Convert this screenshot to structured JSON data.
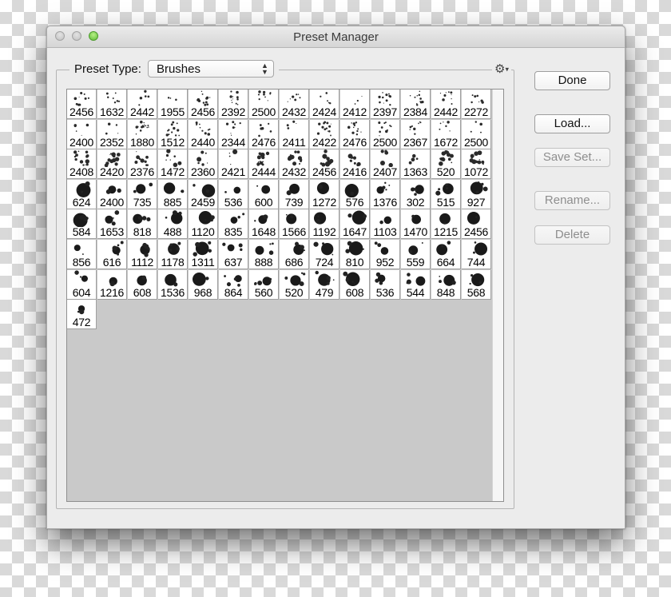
{
  "window": {
    "title": "Preset Manager"
  },
  "preset_type": {
    "label": "Preset Type:",
    "value": "Brushes"
  },
  "menu": {
    "icon": "gear-icon"
  },
  "buttons": {
    "done": "Done",
    "load": "Load...",
    "save_set": "Save Set...",
    "rename": "Rename...",
    "delete": "Delete"
  },
  "brushes": [
    "2456",
    "1632",
    "2442",
    "1955",
    "2456",
    "2392",
    "2500",
    "2432",
    "2424",
    "2412",
    "2397",
    "2384",
    "2442",
    "2272",
    "2400",
    "2352",
    "1880",
    "1512",
    "2440",
    "2344",
    "2476",
    "2411",
    "2422",
    "2476",
    "2500",
    "2367",
    "1672",
    "2500",
    "2408",
    "2420",
    "2376",
    "1472",
    "2360",
    "2421",
    "2444",
    "2432",
    "2456",
    "2416",
    "2407",
    "1363",
    "520",
    "1072",
    "624",
    "2400",
    "735",
    "885",
    "2459",
    "536",
    "600",
    "739",
    "1272",
    "576",
    "1376",
    "302",
    "515",
    "927",
    "584",
    "1653",
    "818",
    "488",
    "1120",
    "835",
    "1648",
    "1566",
    "1192",
    "1647",
    "1103",
    "1470",
    "1215",
    "2456",
    "856",
    "616",
    "1112",
    "1178",
    "1311",
    "637",
    "888",
    "686",
    "724",
    "810",
    "952",
    "559",
    "664",
    "744",
    "604",
    "1216",
    "608",
    "1536",
    "968",
    "864",
    "560",
    "520",
    "479",
    "608",
    "536",
    "544",
    "848",
    "568",
    "472"
  ]
}
